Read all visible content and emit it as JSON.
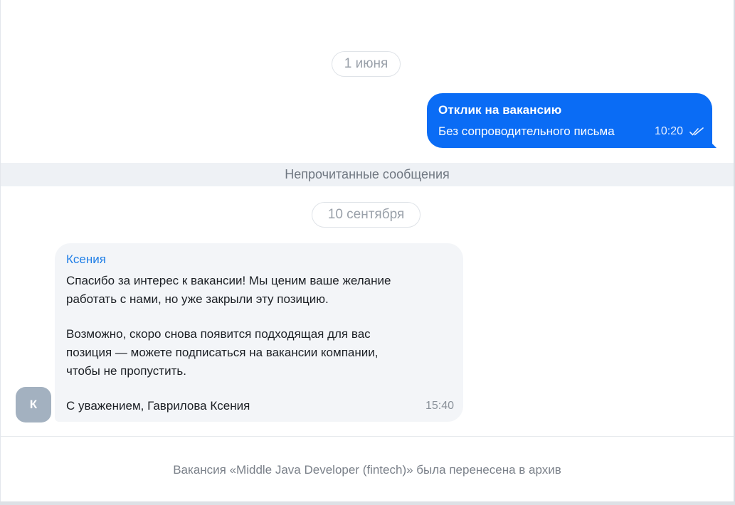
{
  "dates": {
    "first": "1 июня",
    "second": "10 сентября"
  },
  "outgoing_message": {
    "title": "Отклик на вакансию",
    "body": "Без сопроводительного письма",
    "time": "10:20",
    "status_icon": "double-check-icon",
    "bubble_color": "#0a6cf5"
  },
  "unread_divider": "Непрочитанные сообщения",
  "incoming_message": {
    "sender": "Ксения",
    "lines": [
      "Спасибо за интерес к вакансии! Мы ценим ваше желание",
      "работать с нами, но уже закрыли эту позицию.",
      "Возможно, скоро снова появится подходящая для вас",
      "позиция — можете подписаться на вакансии компании,",
      "чтобы не пропустить.",
      "С уважением, Гаврилова Ксения"
    ],
    "time": "15:40",
    "avatar_letter": "К"
  },
  "archive_notice": "Вакансия «Middle Java Developer (fintech)» была перенесена в архив"
}
